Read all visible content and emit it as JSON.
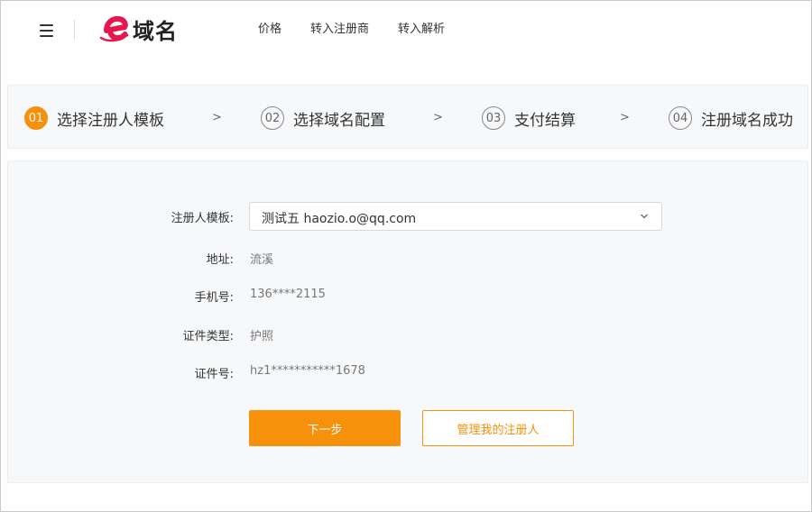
{
  "header": {
    "logo_text": "域名",
    "nav": [
      "价格",
      "转入注册商",
      "转入解析"
    ]
  },
  "steps": [
    {
      "num": "01",
      "label": "选择注册人模板",
      "active": true
    },
    {
      "num": "02",
      "label": "选择域名配置",
      "active": false
    },
    {
      "num": "03",
      "label": "支付结算",
      "active": false
    },
    {
      "num": "04",
      "label": "注册域名成功",
      "active": false
    }
  ],
  "step_separator": ">",
  "form": {
    "template_label": "注册人模板:",
    "template_value": "测试五 haozio.o@qq.com",
    "address_label": "地址:",
    "address_value": "流溪",
    "phone_label": "手机号:",
    "phone_value": "136****2115",
    "id_type_label": "证件类型:",
    "id_type_value": "护照",
    "id_number_label": "证件号:",
    "id_number_value": "hz1***********1678"
  },
  "buttons": {
    "next": "下一步",
    "manage": "管理我的注册人"
  },
  "colors": {
    "accent": "#f7900a",
    "logo": "#e6174f"
  }
}
